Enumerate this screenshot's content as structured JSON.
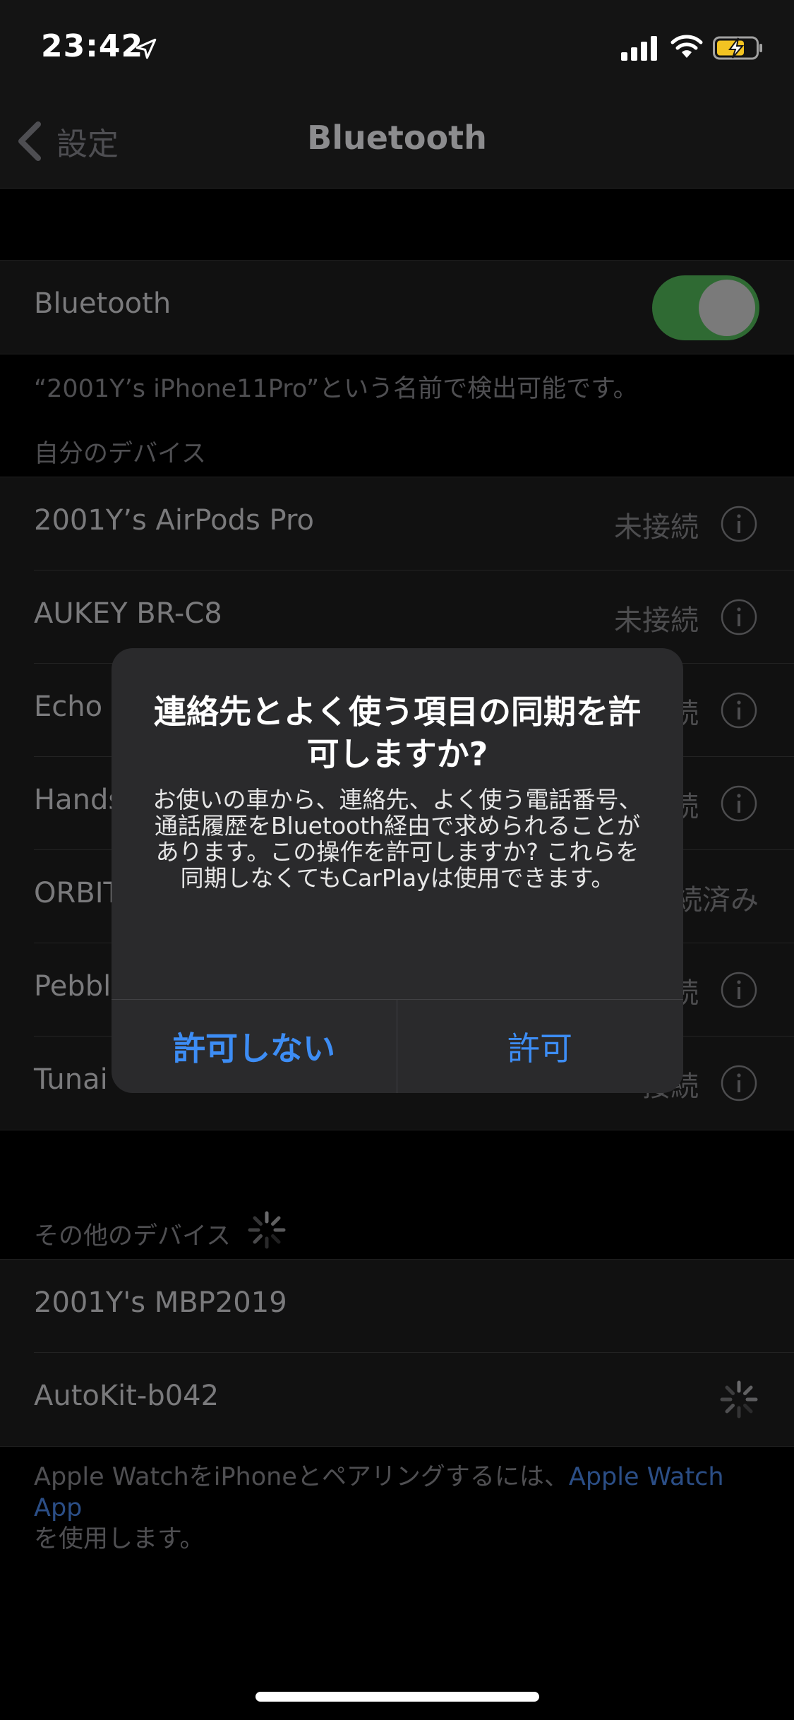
{
  "status_bar": {
    "time": "23:42"
  },
  "nav": {
    "back_label": "設定",
    "title": "Bluetooth"
  },
  "bluetooth_row": {
    "label": "Bluetooth",
    "enabled": true
  },
  "discoverable_caption": "“2001Y’s iPhone11Pro”という名前で検出可能です。",
  "my_devices": {
    "header": "自分のデバイス",
    "items": [
      {
        "name": "2001Y’s AirPods Pro",
        "status": "未接続"
      },
      {
        "name": "AUKEY BR-C8",
        "status": "未接続"
      },
      {
        "name": "Echo",
        "status": "続"
      },
      {
        "name": "Hands",
        "status": "続"
      },
      {
        "name": "ORBIT",
        "status": "続済み"
      },
      {
        "name": "Pebbl",
        "status": "続"
      },
      {
        "name": "Tunai",
        "status": "接続"
      }
    ]
  },
  "other_devices": {
    "header": "その他のデバイス",
    "items": [
      {
        "name": "2001Y's MBP2019"
      },
      {
        "name": "AutoKit-b042"
      }
    ]
  },
  "footer": {
    "text_before": "Apple WatchをiPhoneとペアリングするには、",
    "link": "Apple Watch App",
    "text_after": "を使用します。"
  },
  "alert": {
    "title": "連絡先とよく使う項目の同期を許可しますか?",
    "message": "お使いの車から、連絡先、よく使う電話番号、通話履歴をBluetooth経由で求められることがあります。この操作を許可しますか? これらを同期しなくてもCarPlayは使用できます。",
    "deny_label": "許可しない",
    "allow_label": "許可"
  },
  "colors": {
    "accent": "#3d8df5",
    "toggle_on": "#2f6a33",
    "link": "#2b4e86"
  }
}
